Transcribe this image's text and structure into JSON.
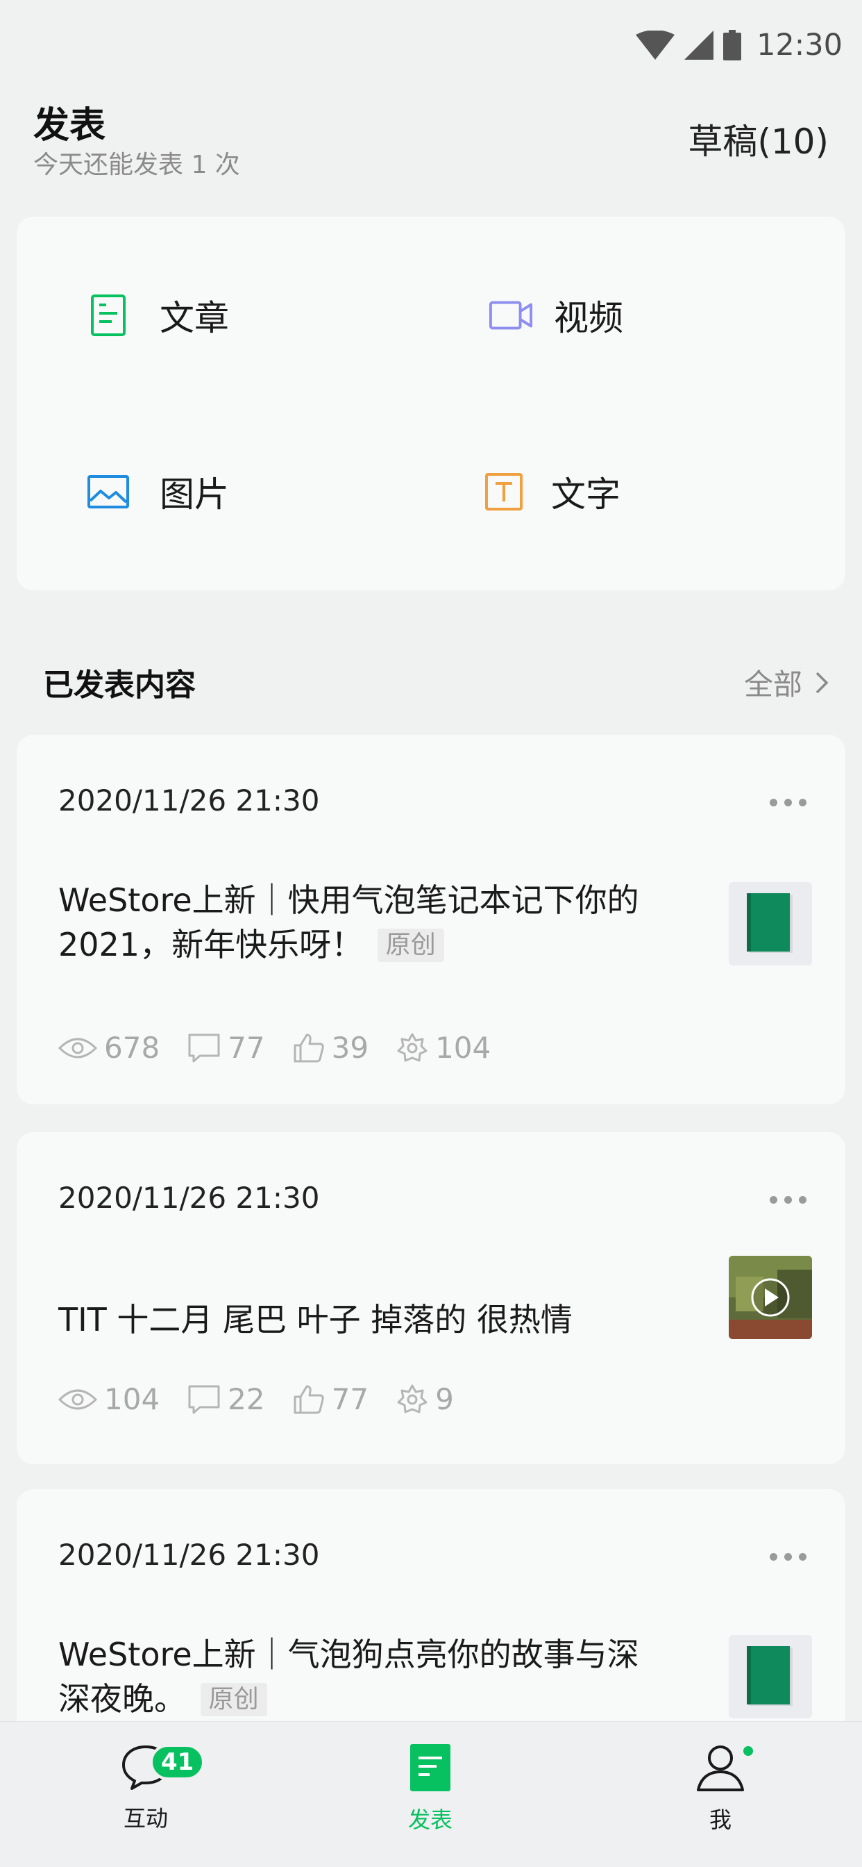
{
  "status_bar": {
    "time": "12:30"
  },
  "header": {
    "title": "发表",
    "subtitle": "今天还能发表 1 次",
    "drafts": "草稿(10)"
  },
  "create": {
    "items": [
      {
        "label": "文章",
        "icon": "article-icon",
        "color": "#07c160"
      },
      {
        "label": "视频",
        "icon": "video-icon",
        "color": "#8e8ef0"
      },
      {
        "label": "图片",
        "icon": "image-icon",
        "color": "#1f8ce0"
      },
      {
        "label": "文字",
        "icon": "text-icon",
        "color": "#f0a040"
      }
    ]
  },
  "section": {
    "title": "已发表内容",
    "all_label": "全部"
  },
  "posts": [
    {
      "date": "2020/11/26 21:30",
      "title": "WeStore上新｜快用气泡笔记本记下你的2021，新年快乐呀！",
      "tag": "原创",
      "thumb": "notebook",
      "stats": {
        "views": "678",
        "comments": "77",
        "likes": "39",
        "shares": "104"
      }
    },
    {
      "date": "2020/11/26 21:30",
      "title": "TIT 十二月 尾巴 叶子 掉落的 很热情",
      "tag": "",
      "thumb": "video",
      "stats": {
        "views": "104",
        "comments": "22",
        "likes": "77",
        "shares": "9"
      }
    },
    {
      "date": "2020/11/26 21:30",
      "title": "WeStore上新｜气泡狗点亮你的故事与深深夜晚。",
      "tag": "原创",
      "thumb": "notebook",
      "stats": {}
    }
  ],
  "tabbar": {
    "items": [
      {
        "label": "互动",
        "badge": "41"
      },
      {
        "label": "发表"
      },
      {
        "label": "我"
      }
    ]
  },
  "colors": {
    "accent": "#07c160",
    "background": "#f0f1f1",
    "card": "#f8f9f9"
  }
}
